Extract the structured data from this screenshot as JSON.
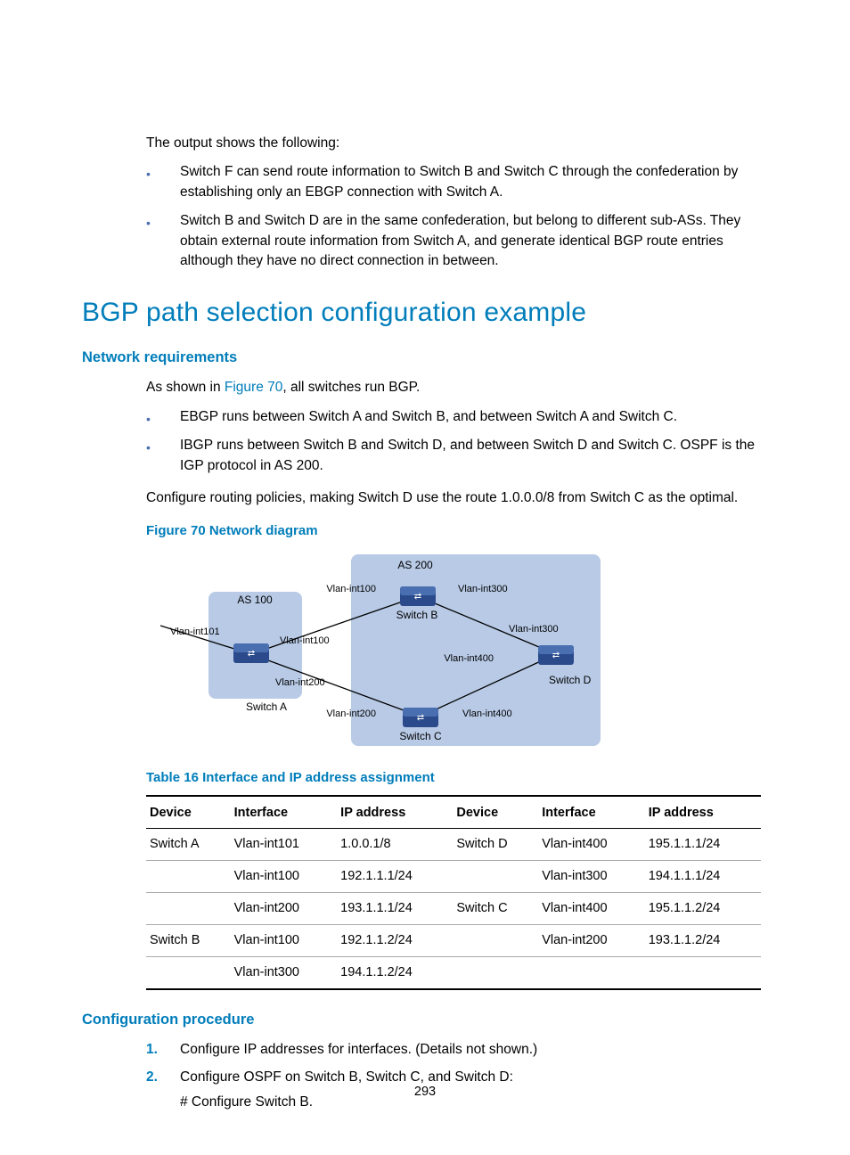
{
  "intro": {
    "lead": "The output shows the following:",
    "bullets": [
      "Switch F can send route information to Switch B and Switch C through the confederation by establishing only an EBGP connection with Switch A.",
      "Switch B and Switch D are in the same confederation, but belong to different sub-ASs. They obtain external route information from Switch A, and generate identical BGP route entries although they have no direct connection in between."
    ]
  },
  "section": {
    "title": "BGP path selection configuration example",
    "netreq": {
      "heading": "Network requirements",
      "lead_pre": "As shown in ",
      "lead_link": "Figure 70",
      "lead_post": ", all switches run BGP.",
      "bullets": [
        "EBGP runs between Switch A and Switch B, and between Switch A and Switch C.",
        "IBGP runs between Switch B and Switch D, and between Switch D and Switch C. OSPF is the IGP protocol in AS 200."
      ],
      "para": "Configure routing policies, making Switch D use the route 1.0.0.0/8 from Switch C as the optimal."
    },
    "figure": {
      "caption": "Figure 70 Network diagram",
      "labels": {
        "as100": "AS 100",
        "as200": "AS 200",
        "switchA": "Switch A",
        "switchB": "Switch B",
        "switchC": "Switch C",
        "switchD": "Switch D",
        "vlan101": "Vlan-int101",
        "vlan100a": "Vlan-int100",
        "vlan100b": "Vlan-int100",
        "vlan200a": "Vlan-int200",
        "vlan200b": "Vlan-int200",
        "vlan300a": "Vlan-int300",
        "vlan300b": "Vlan-int300",
        "vlan400a": "Vlan-int400",
        "vlan400b": "Vlan-int400"
      }
    },
    "table": {
      "caption": "Table 16 Interface and IP address assignment",
      "headers": [
        "Device",
        "Interface",
        "IP address",
        "Device",
        "Interface",
        "IP address"
      ],
      "rows": [
        [
          "Switch A",
          "Vlan-int101",
          "1.0.0.1/8",
          "Switch D",
          "Vlan-int400",
          "195.1.1.1/24"
        ],
        [
          "",
          "Vlan-int100",
          "192.1.1.1/24",
          "",
          "Vlan-int300",
          "194.1.1.1/24"
        ],
        [
          "",
          "Vlan-int200",
          "193.1.1.1/24",
          "Switch C",
          "Vlan-int400",
          "195.1.1.2/24"
        ],
        [
          "Switch B",
          "Vlan-int100",
          "192.1.1.2/24",
          "",
          "Vlan-int200",
          "193.1.1.2/24"
        ],
        [
          "",
          "Vlan-int300",
          "194.1.1.2/24",
          "",
          "",
          ""
        ]
      ]
    },
    "proc": {
      "heading": "Configuration procedure",
      "steps": [
        {
          "num": "1.",
          "text": "Configure IP addresses for interfaces. (Details not shown.)"
        },
        {
          "num": "2.",
          "text": "Configure OSPF on Switch B, Switch C, and Switch D:",
          "sub": "# Configure Switch B."
        }
      ]
    }
  },
  "page": "293"
}
